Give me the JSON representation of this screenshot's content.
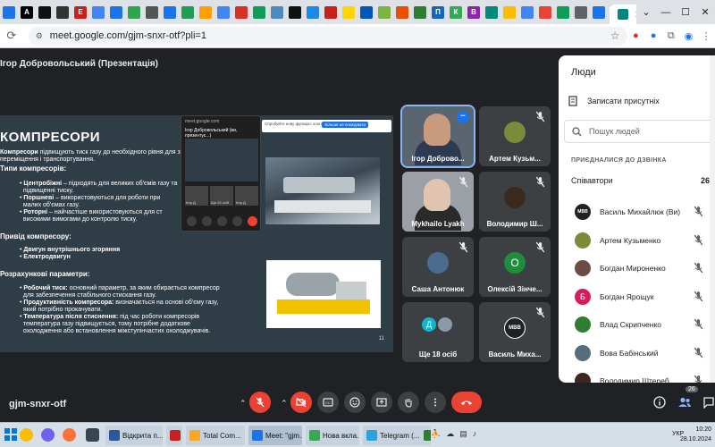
{
  "browser": {
    "active_tab_title": "Meet: gjm-snxr-otf",
    "url": "meet.google.com/gjm-snxr-otf?pli=1",
    "tab_icons": [
      "#1a73e8",
      "#000",
      "#111",
      "#333",
      "#c5221f",
      "#4285f4",
      "#1a73e8",
      "#2ea44f",
      "#555",
      "#1a73e8",
      "#1f9d55",
      "#ffa000",
      "#4285f4",
      "#d93025",
      "#0f9d58",
      "#4b8bbe",
      "#111",
      "#1e88e5",
      "#c5221f",
      "#ffd400",
      "#0057b7",
      "#7cb342",
      "#e65100",
      "#2e7d32",
      "#1565c0",
      "#34a853",
      "#8e24aa",
      "#00897b",
      "#fbbc04",
      "#4285f4",
      "#ea4335",
      "#0f9d58",
      "#5f6368",
      "#1a73e8",
      "#d93025",
      "#1565c0",
      "#444",
      "#212121"
    ],
    "tab_letters": [
      "",
      "A",
      "",
      "",
      "E",
      "",
      "",
      "",
      "",
      "",
      "",
      "",
      "",
      "",
      "",
      "",
      "",
      "",
      "",
      "",
      "",
      "",
      "",
      "",
      "П",
      "К",
      "В",
      "",
      "",
      "",
      "",
      "",
      "",
      "",
      "",
      "LK",
      "",
      "U"
    ]
  },
  "meet": {
    "presenter_label": "Ігор Добровольський (Презентація)",
    "meeting_code": "gjm-snxr-otf",
    "slide": {
      "title": "КОМПРЕСОРИ",
      "intro_b": "Компресори",
      "intro": " підвищують тиск газу до необхідного рівня для зберігання",
      "intro2": "переміщення і транспортування.",
      "types_head": "Типи компресорів:",
      "t1_b": "Центробіжні",
      "t1": " – підходять для великих об'ємів газу та",
      "t1b": "підвищенні тиску.",
      "t2_b": "Поршневі",
      "t2": " – використовуються для роботи при",
      "t2b": "малих об'ємах газу.",
      "t3_b": "Роторні",
      "t3": " – найчастіше використовуються для ст",
      "t3b": "високими вимогами до контролю тиску.",
      "drive_head": "Привід компресору:",
      "d1": "Двигун внутрішнього згоряння",
      "d2": "Електродвигун",
      "calc_head": "Розрахункові параметри:",
      "c1_b": "Робочий тиск:",
      "c1": " основний параметр, за яким обирається компресор",
      "c1b": "для забезпечення стабільного стискання газу.",
      "c2_b": "Продуктивність компресора:",
      "c2": " визначається на основі об'єму газу,",
      "c2b": "який потрібно прокачувати.",
      "c3_b": "Температура після стиснення:",
      "c3": " під час роботи компресорів",
      "c3b": "температура газу підвищується, тому потрібне додаткове",
      "c3c": "охолодження або встановлення міжступінчастих охолоджувачів.",
      "page_number": "11"
    },
    "popup": {
      "url": "meet.google.com",
      "title": "Ігор Добровольський (ви, презентує...)",
      "tile1": "Ігор Д.",
      "tile2": "Ще 23 осіб",
      "tile3": "Ігор Д."
    },
    "notice": {
      "text": "Спробуйте нову функцію: кнопки на панелі",
      "button": "Більше не показувати"
    },
    "participants": [
      {
        "name": "Ігор Доброво...",
        "kind": "video",
        "active": true
      },
      {
        "name": "Артем Кузьм...",
        "kind": "avatar",
        "color": "#7b8b3a",
        "letter": ""
      },
      {
        "name": "Mykhailo Lyakh",
        "kind": "video2",
        "active": false
      },
      {
        "name": "Володимир Ш...",
        "kind": "avatar",
        "color": "#3a2a1e",
        "letter": ""
      },
      {
        "name": "Саша Антонюк",
        "kind": "avatar",
        "color": "#4b6c8f",
        "letter": ""
      },
      {
        "name": "Олексій Зінче...",
        "kind": "avatar",
        "color": "#1e8e3e",
        "letter": "О"
      },
      {
        "name": "Ще 18 осіб",
        "kind": "more",
        "letter": "Д"
      },
      {
        "name": "Василь Миха...",
        "kind": "avatar",
        "color": "#202124",
        "letter": "MBB"
      }
    ]
  },
  "people": {
    "title": "Люди",
    "record_label": "Записати присутніх",
    "search_placeholder": "Пошук людей",
    "section_label": "ПРИЄДНАЛИСЯ ДО ДЗВІНКА",
    "group_label": "Співавтори",
    "group_count": "26",
    "rows": [
      {
        "name": "Василь Михайлюк (Ви)",
        "color": "#202124",
        "letter": "MBB"
      },
      {
        "name": "Артем Кузьменко",
        "color": "#7b8b3a",
        "letter": ""
      },
      {
        "name": "Богдан Мироненко",
        "color": "#6d4c41",
        "letter": ""
      },
      {
        "name": "Богдан Ярощук",
        "color": "#d81b60",
        "letter": "Б"
      },
      {
        "name": "Влад Скрипченко",
        "color": "#2e7d32",
        "letter": ""
      },
      {
        "name": "Вова Бабінський",
        "color": "#546e7a",
        "letter": ""
      },
      {
        "name": "Володимир Штереб",
        "color": "#3e2723",
        "letter": ""
      }
    ]
  },
  "controls": {
    "participants_badge": "26"
  },
  "taskbar": {
    "apps": [
      {
        "label": "Відкрита п...",
        "color": "#2b579a"
      },
      {
        "label": "",
        "color": "#c5221f"
      },
      {
        "label": "Total Com...",
        "color": "#f9a825"
      },
      {
        "label": "Meet: \"gjm...",
        "color": "#1a73e8"
      },
      {
        "label": "Нова вкла...",
        "color": "#34a853"
      },
      {
        "label": "Telegram (...",
        "color": "#2aa3df"
      },
      {
        "label": "",
        "color": "#2e7d32"
      }
    ],
    "lang": "УКР",
    "time": "10:20",
    "date": "28.10.2024"
  }
}
